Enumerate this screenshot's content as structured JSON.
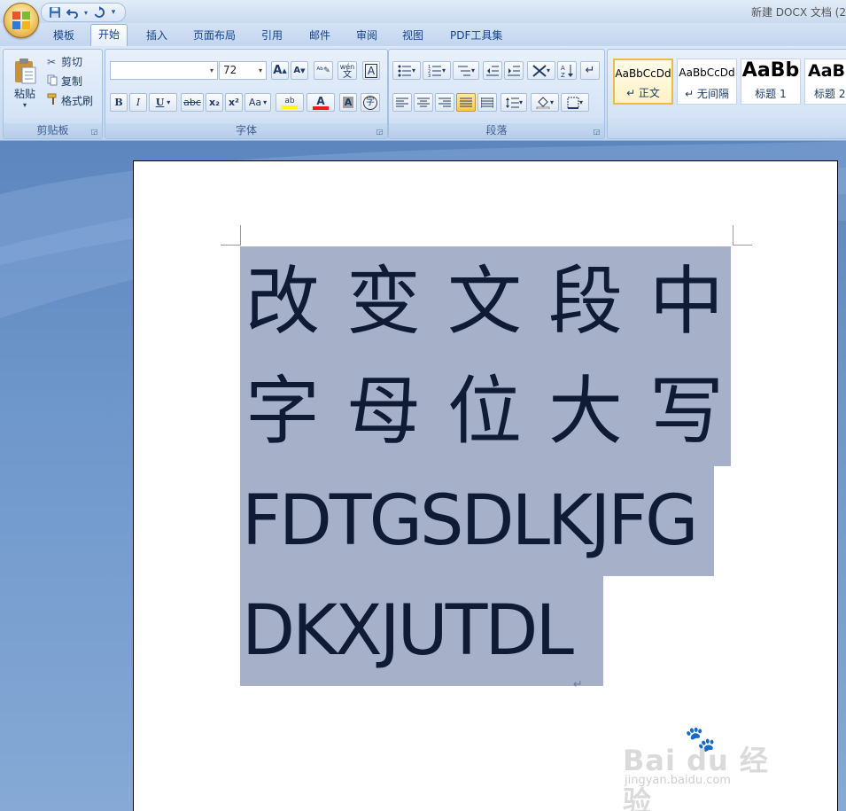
{
  "title_bar": {
    "document_title": "新建 DOCX 文档 (2"
  },
  "quick_access": {
    "save_icon": "save-icon",
    "undo_icon": "undo-icon",
    "redo_icon": "redo-icon",
    "customize_icon": "customize-icon"
  },
  "tabs": [
    {
      "label": "模板"
    },
    {
      "label": "开始"
    },
    {
      "label": "插入"
    },
    {
      "label": "页面布局"
    },
    {
      "label": "引用"
    },
    {
      "label": "邮件"
    },
    {
      "label": "审阅"
    },
    {
      "label": "视图"
    },
    {
      "label": "PDF工具集"
    }
  ],
  "active_tab": "开始",
  "clipboard": {
    "group_label": "剪贴板",
    "paste_label": "粘贴",
    "cut_label": "剪切",
    "copy_label": "复制",
    "format_painter_label": "格式刷"
  },
  "font": {
    "group_label": "字体",
    "font_name_value": "",
    "font_size_value": "72",
    "grow_label": "A",
    "shrink_label": "A",
    "phonetic_label": "wén",
    "border_label": "A",
    "bold_label": "B",
    "italic_label": "I",
    "underline_label": "U",
    "strike_label": "abc",
    "subscript_label": "x₂",
    "superscript_label": "x²",
    "case_label": "Aa",
    "highlight_label": "ab",
    "font_color_label": "A",
    "shading_label": "A",
    "enclose_label": "字"
  },
  "paragraph": {
    "group_label": "段落"
  },
  "styles": {
    "items": [
      {
        "sample": "AaBbCcDd",
        "name": "↵ 正文"
      },
      {
        "sample": "AaBbCcDd",
        "name": "↵ 无间隔"
      },
      {
        "sample": "AaBb",
        "name": "标题 1"
      },
      {
        "sample": "AaBl",
        "name": "标题 2"
      }
    ]
  },
  "document": {
    "lines": [
      "改变文段中",
      "字母位大写",
      "FDTGSDLKJFG",
      "DKXJUTDL"
    ],
    "paragraph_mark": "↵",
    "selection_color": "#a7b0c9"
  },
  "watermark": {
    "brand": "Bai du 经验",
    "url": "jingyan.baidu.com"
  },
  "colors": {
    "ribbon": "#d5e4f6",
    "workspace": "#6e97cb",
    "highlight_yellow": "#ffff00",
    "font_red": "#e02020"
  }
}
